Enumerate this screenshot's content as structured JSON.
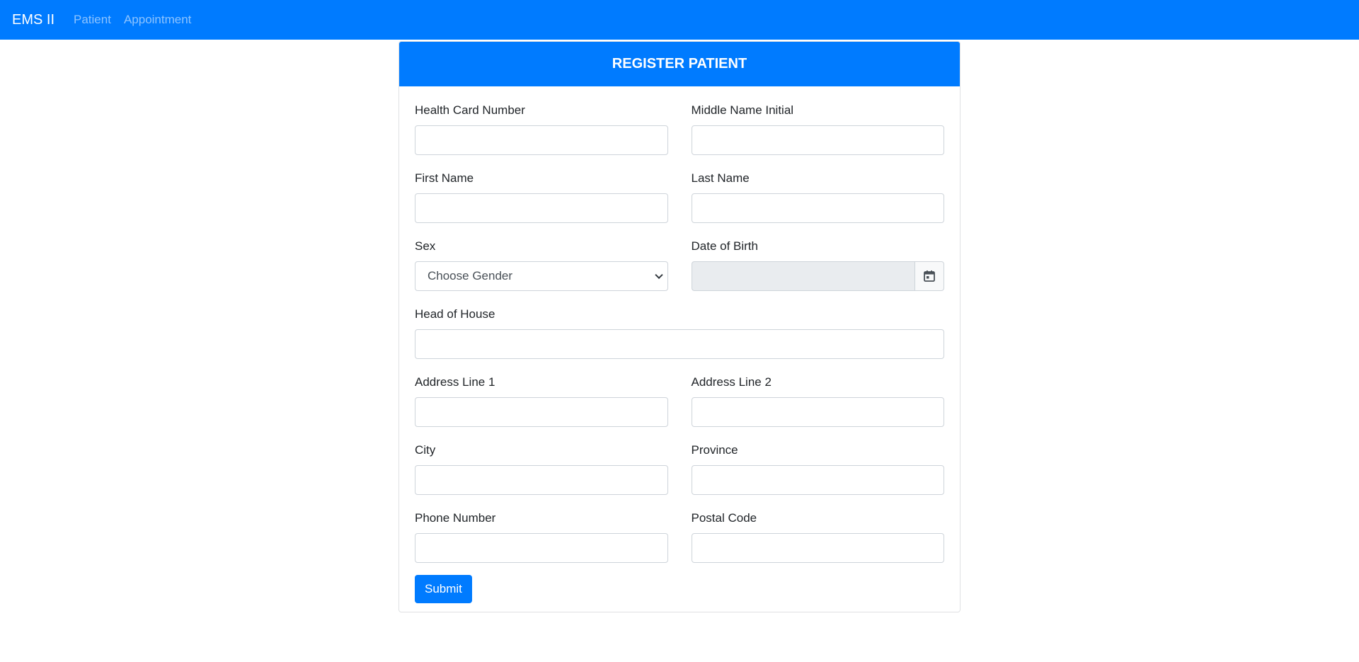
{
  "navbar": {
    "brand": "EMS II",
    "links": [
      "Patient",
      "Appointment"
    ]
  },
  "form": {
    "title": "REGISTER PATIENT",
    "fields": {
      "health_card": {
        "label": "Health Card Number",
        "value": ""
      },
      "middle_initial": {
        "label": "Middle Name Initial",
        "value": ""
      },
      "first_name": {
        "label": "First Name",
        "value": ""
      },
      "last_name": {
        "label": "Last Name",
        "value": ""
      },
      "sex": {
        "label": "Sex",
        "selected": "Choose Gender"
      },
      "dob": {
        "label": "Date of Birth",
        "value": "",
        "icon": "calendar-icon"
      },
      "head_of_house": {
        "label": "Head of House",
        "value": ""
      },
      "address1": {
        "label": "Address Line 1",
        "value": ""
      },
      "address2": {
        "label": "Address Line 2",
        "value": ""
      },
      "city": {
        "label": "City",
        "value": ""
      },
      "province": {
        "label": "Province",
        "value": ""
      },
      "phone": {
        "label": "Phone Number",
        "value": ""
      },
      "postal": {
        "label": "Postal Code",
        "value": ""
      }
    },
    "submit_label": "Submit"
  },
  "colors": {
    "primary": "#007bff",
    "border": "#ced4da",
    "disabled_bg": "#e9ecef"
  }
}
